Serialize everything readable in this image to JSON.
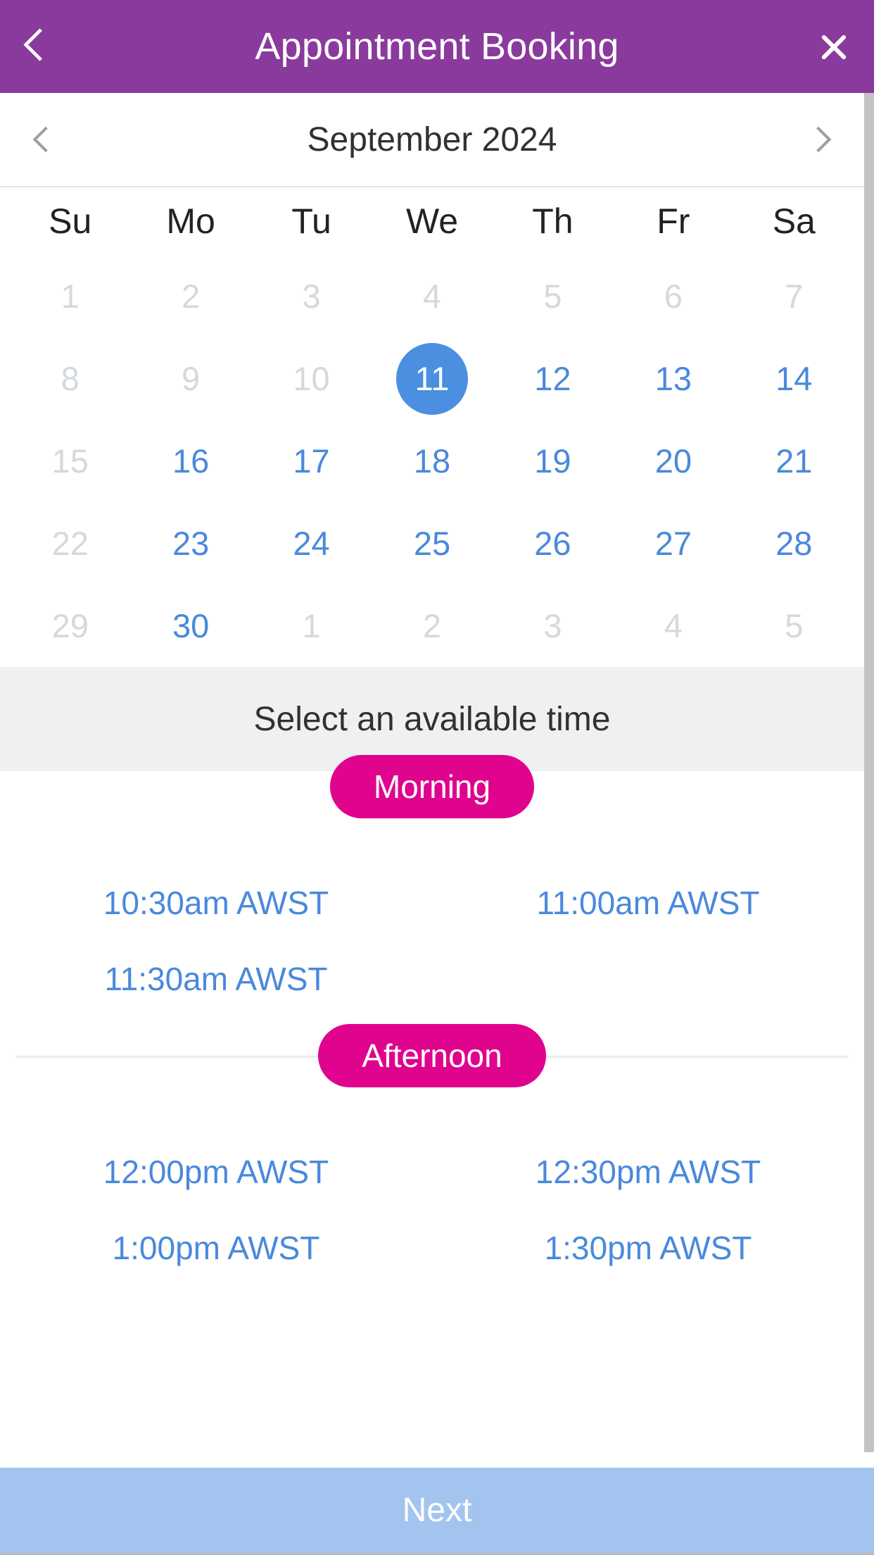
{
  "appbar": {
    "title": "Appointment Booking",
    "back_icon": "chevron-left-icon",
    "close_icon": "close-icon",
    "background": "#8a3a9c",
    "text_color": "#ffffff"
  },
  "calendar": {
    "month_label": "September 2024",
    "prev_icon": "chevron-left-icon",
    "next_icon": "chevron-right-icon",
    "weekdays": [
      "Su",
      "Mo",
      "Tu",
      "We",
      "Th",
      "Fr",
      "Sa"
    ],
    "selected_day": "11",
    "selected_color": "#4a8fe0",
    "available_color": "#4a89dc",
    "disabled_color": "#d4d9dd",
    "weeks": [
      [
        {
          "label": "1",
          "state": "disabled"
        },
        {
          "label": "2",
          "state": "disabled"
        },
        {
          "label": "3",
          "state": "disabled"
        },
        {
          "label": "4",
          "state": "disabled"
        },
        {
          "label": "5",
          "state": "disabled"
        },
        {
          "label": "6",
          "state": "disabled"
        },
        {
          "label": "7",
          "state": "disabled"
        }
      ],
      [
        {
          "label": "8",
          "state": "disabled"
        },
        {
          "label": "9",
          "state": "disabled"
        },
        {
          "label": "10",
          "state": "disabled"
        },
        {
          "label": "11",
          "state": "selected"
        },
        {
          "label": "12",
          "state": "avail"
        },
        {
          "label": "13",
          "state": "avail"
        },
        {
          "label": "14",
          "state": "avail"
        }
      ],
      [
        {
          "label": "15",
          "state": "disabled"
        },
        {
          "label": "16",
          "state": "avail"
        },
        {
          "label": "17",
          "state": "avail"
        },
        {
          "label": "18",
          "state": "avail"
        },
        {
          "label": "19",
          "state": "avail"
        },
        {
          "label": "20",
          "state": "avail"
        },
        {
          "label": "21",
          "state": "avail"
        }
      ],
      [
        {
          "label": "22",
          "state": "disabled"
        },
        {
          "label": "23",
          "state": "avail"
        },
        {
          "label": "24",
          "state": "avail"
        },
        {
          "label": "25",
          "state": "avail"
        },
        {
          "label": "26",
          "state": "avail"
        },
        {
          "label": "27",
          "state": "avail"
        },
        {
          "label": "28",
          "state": "avail"
        }
      ],
      [
        {
          "label": "29",
          "state": "disabled"
        },
        {
          "label": "30",
          "state": "avail"
        },
        {
          "label": "1",
          "state": "disabled"
        },
        {
          "label": "2",
          "state": "disabled"
        },
        {
          "label": "3",
          "state": "disabled"
        },
        {
          "label": "4",
          "state": "disabled"
        },
        {
          "label": "5",
          "state": "disabled"
        }
      ]
    ]
  },
  "time_section": {
    "heading": "Select an available time",
    "pill_color": "#e0038d",
    "groups": [
      {
        "label": "Morning",
        "slots": [
          "10:30am AWST",
          "11:00am AWST",
          "11:30am AWST"
        ]
      },
      {
        "label": "Afternoon",
        "slots": [
          "12:00pm AWST",
          "12:30pm AWST",
          "1:00pm AWST",
          "1:30pm AWST"
        ]
      }
    ]
  },
  "footer": {
    "next_label": "Next",
    "background": "#a3c4ee"
  }
}
